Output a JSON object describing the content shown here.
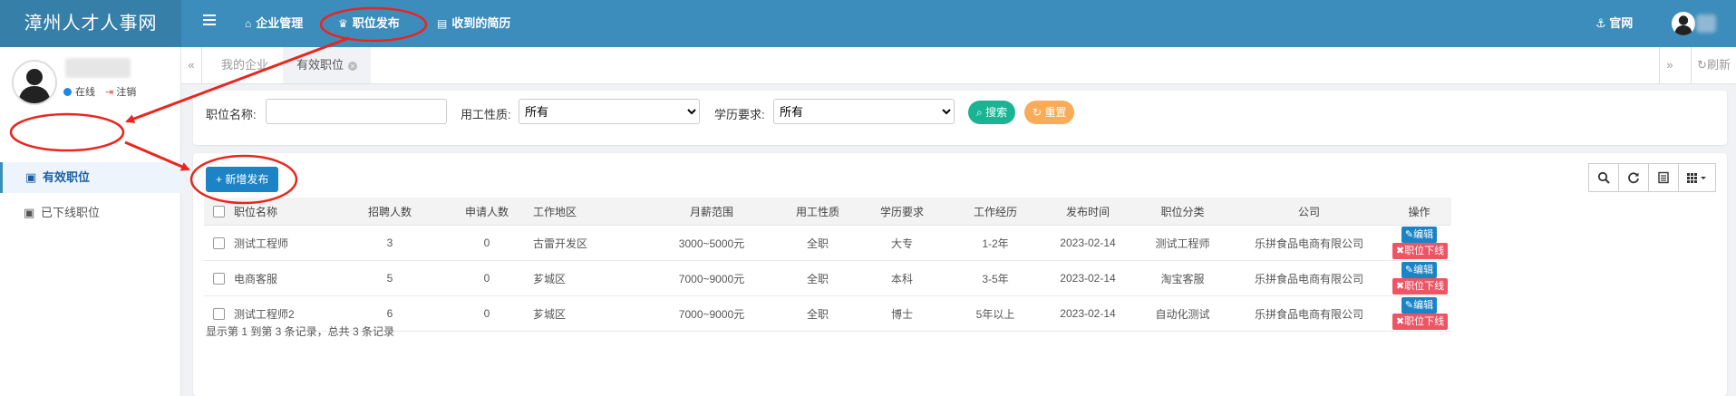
{
  "app": {
    "title": "漳州人才人事网"
  },
  "topnav": {
    "company_manage": "企业管理",
    "job_publish": "职位发布",
    "resumes": "收到的简历",
    "official_site": "官网"
  },
  "user": {
    "status": "在线",
    "logout": "注销"
  },
  "sidebar": {
    "items": [
      {
        "label": "有效职位"
      },
      {
        "label": "已下线职位"
      }
    ]
  },
  "tabs": [
    {
      "label": "我的企业"
    },
    {
      "label": "有效职位"
    }
  ],
  "refresh_label": "刷新",
  "filters": {
    "job_name_label": "职位名称:",
    "job_name_value": "",
    "work_type_label": "用工性质:",
    "work_type_value": "所有",
    "education_label": "学历要求:",
    "education_value": "所有",
    "search_button": "搜索",
    "reset_button": "重置"
  },
  "add_button": "新增发布",
  "table": {
    "headers": [
      "职位名称",
      "招聘人数",
      "申请人数",
      "工作地区",
      "月薪范围",
      "用工性质",
      "学历要求",
      "工作经历",
      "发布时间",
      "职位分类",
      "公司",
      "操作"
    ],
    "rows": [
      [
        "测试工程师",
        "3",
        "0",
        "古雷开发区",
        "3000~5000元",
        "全职",
        "大专",
        "1-2年",
        "2023-02-14",
        "测试工程师",
        "乐拼食品电商有限公司"
      ],
      [
        "电商客服",
        "5",
        "0",
        "芗城区",
        "7000~9000元",
        "全职",
        "本科",
        "3-5年",
        "2023-02-14",
        "淘宝客服",
        "乐拼食品电商有限公司"
      ],
      [
        "测试工程师2",
        "6",
        "0",
        "芗城区",
        "7000~9000元",
        "全职",
        "博士",
        "5年以上",
        "2023-02-14",
        "自动化测试",
        "乐拼食品电商有限公司"
      ]
    ],
    "edit_label": "编辑",
    "offline_label": "职位下线"
  },
  "pagination_text": "显示第 1 到第 3 条记录，总共 3 条记录",
  "icons": {
    "burger": "menu-icon",
    "company": "home-icon",
    "publish": "trophy-icon",
    "resume": "newspaper-icon",
    "official": "anchor-icon",
    "refresh": "refresh-icon",
    "search": "search-icon",
    "columns": "grid-icon"
  },
  "colors": {
    "header": "#3c8dbc",
    "logo_bg": "#367fa9",
    "primary": "#1c84c6",
    "success": "#1ab394",
    "warning": "#f8ac59",
    "danger": "#ed5565",
    "annotation": "#e8261f"
  }
}
